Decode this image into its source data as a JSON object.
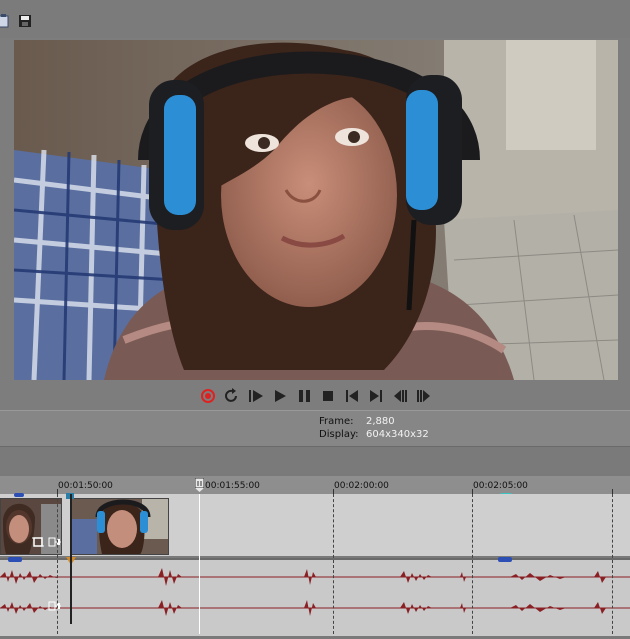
{
  "toolbar": {
    "icons": [
      "clipboard-icon",
      "save-icon"
    ]
  },
  "preview": {
    "frame_label": "Frame:",
    "frame_value": "2,880",
    "display_label": "Display:",
    "display_value": "604x340x32"
  },
  "transport": {
    "buttons": [
      "record",
      "loop",
      "play-from-start",
      "play",
      "pause",
      "stop",
      "go-to-start",
      "go-to-end",
      "prev-frame",
      "next-frame"
    ]
  },
  "timeline": {
    "markers": [
      "00:01:50:00",
      "00:01:55:00",
      "00:02:00:00",
      "00:02:05:00"
    ]
  },
  "colors": {
    "accent_record": "#d22",
    "waveform": "#8a1f24",
    "cursor": "#ffffff"
  }
}
